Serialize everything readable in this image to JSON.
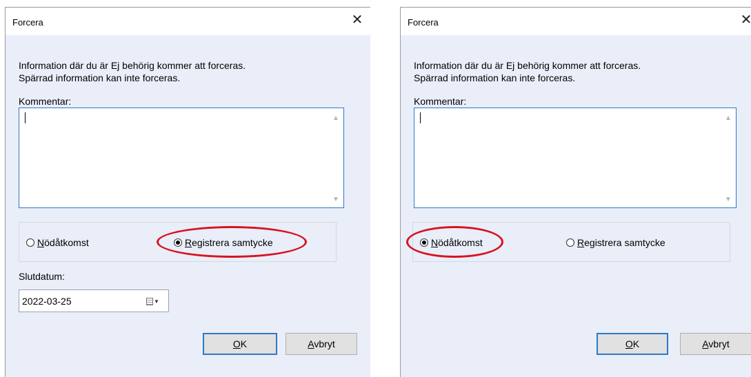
{
  "dialogs": [
    {
      "title": "Forcera",
      "info_line1": "Information där du är Ej behörig kommer att forceras.",
      "info_line2": "Spärrad information kan inte forceras.",
      "comment_label": "Kommentar:",
      "comment_value": "",
      "radio_emergency": {
        "label_first": "N",
        "label_rest": "ödåtkomst",
        "checked": false
      },
      "radio_consent": {
        "label_first": "R",
        "label_rest": "egistrera samtycke",
        "checked": true
      },
      "end_date_label": "Slutdatum:",
      "end_date_value": "2022-03-25",
      "ok_first": "O",
      "ok_rest": "K",
      "cancel_first": "A",
      "cancel_rest": "vbryt"
    },
    {
      "title": "Forcera",
      "info_line1": "Information där du är Ej behörig kommer att forceras.",
      "info_line2": "Spärrad information kan inte forceras.",
      "comment_label": "Kommentar:",
      "comment_value": "",
      "radio_emergency": {
        "label_first": "N",
        "label_rest": "ödåtkomst",
        "checked": true
      },
      "radio_consent": {
        "label_first": "R",
        "label_rest": "egistrera samtycke",
        "checked": false
      },
      "ok_first": "O",
      "ok_rest": "K",
      "cancel_first": "A",
      "cancel_rest": "vbryt"
    }
  ],
  "colors": {
    "dialog_bg": "#e9eef9",
    "accent_border": "#2f78c4",
    "highlight_ellipse": "#d8131f"
  },
  "icons": [
    "close-icon",
    "scroll-up-icon",
    "scroll-down-icon",
    "calendar-icon"
  ]
}
